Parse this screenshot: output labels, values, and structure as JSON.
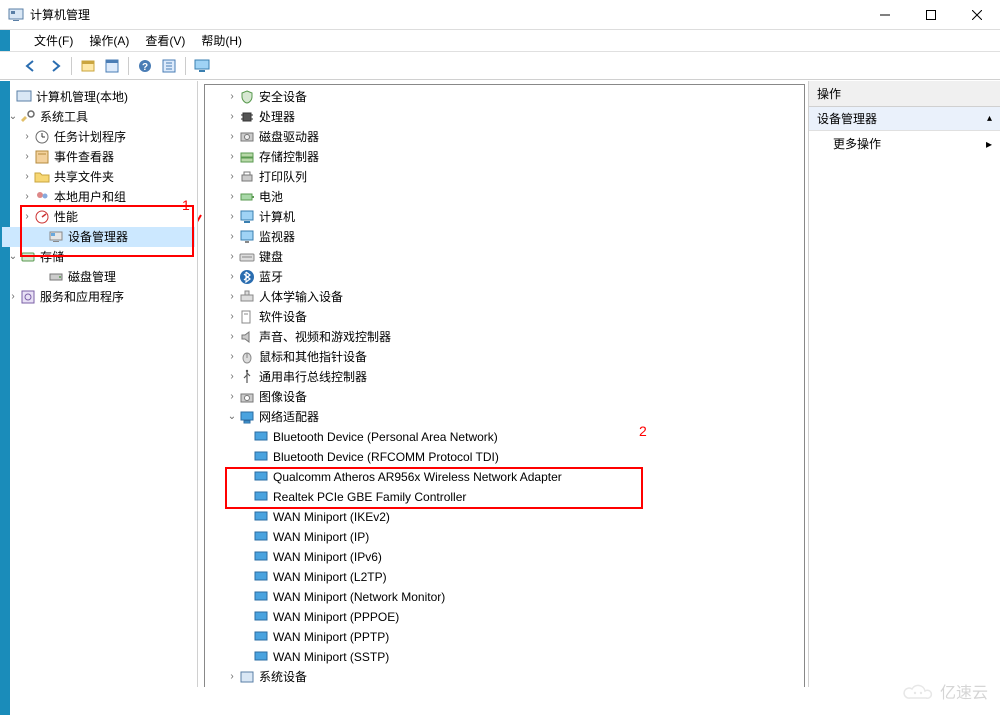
{
  "window": {
    "title": "计算机管理"
  },
  "menus": {
    "file": "文件(F)",
    "action": "操作(A)",
    "view": "查看(V)",
    "help": "帮助(H)"
  },
  "left_tree": {
    "root": "计算机管理(本地)",
    "system_tools": "系统工具",
    "task_scheduler": "任务计划程序",
    "event_viewer": "事件查看器",
    "shared_folders": "共享文件夹",
    "local_users": "本地用户和组",
    "performance": "性能",
    "device_manager": "设备管理器",
    "storage": "存储",
    "disk_mgmt": "磁盘管理",
    "services": "服务和应用程序"
  },
  "device_tree": {
    "security": "安全设备",
    "processor": "处理器",
    "disk_drives": "磁盘驱动器",
    "storage_ctrl": "存储控制器",
    "print_queues": "打印队列",
    "batteries": "电池",
    "computer": "计算机",
    "monitors": "监视器",
    "keyboards": "键盘",
    "bluetooth": "蓝牙",
    "hid": "人体学输入设备",
    "software": "软件设备",
    "sound": "声音、视频和游戏控制器",
    "mice": "鼠标和其他指针设备",
    "usb": "通用串行总线控制器",
    "imaging": "图像设备",
    "network": "网络适配器",
    "net_items": {
      "bt_pan": "Bluetooth Device (Personal Area Network)",
      "bt_rfcomm": "Bluetooth Device (RFCOMM Protocol TDI)",
      "qualcomm": "Qualcomm Atheros AR956x Wireless Network Adapter",
      "realtek": "Realtek PCIe GBE Family Controller",
      "wan_ikev2": "WAN Miniport (IKEv2)",
      "wan_ip": "WAN Miniport (IP)",
      "wan_ipv6": "WAN Miniport (IPv6)",
      "wan_l2tp": "WAN Miniport (L2TP)",
      "wan_netmon": "WAN Miniport (Network Monitor)",
      "wan_pppoe": "WAN Miniport (PPPOE)",
      "wan_pptp": "WAN Miniport (PPTP)",
      "wan_sstp": "WAN Miniport (SSTP)"
    },
    "system_devices": "系统设备"
  },
  "actions": {
    "header": "操作",
    "section": "设备管理器",
    "more": "更多操作"
  },
  "annotations": {
    "label1": "1",
    "label2": "2"
  },
  "watermark": "亿速云"
}
